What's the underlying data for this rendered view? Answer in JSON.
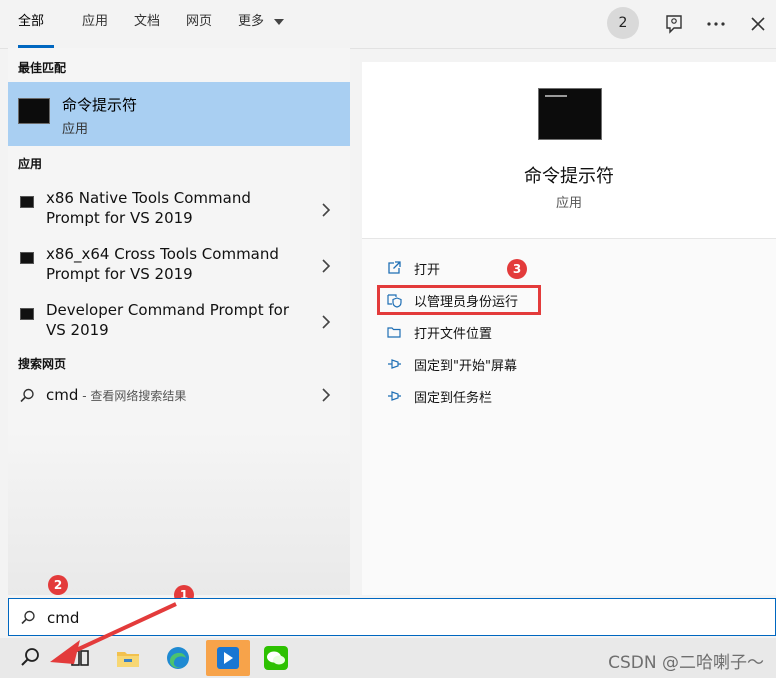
{
  "tabs": [
    {
      "label": "全部",
      "active": true
    },
    {
      "label": "应用"
    },
    {
      "label": "文档"
    },
    {
      "label": "网页"
    },
    {
      "label": "更多"
    }
  ],
  "top_right": {
    "badge": "2",
    "icons": [
      "feedback-icon",
      "more-icon",
      "close-icon"
    ]
  },
  "left": {
    "best_match_title": "最佳匹配",
    "best_match": {
      "name": "命令提示符",
      "type": "应用"
    },
    "apps_title": "应用",
    "apps": [
      {
        "label": "x86 Native Tools Command Prompt for VS 2019"
      },
      {
        "label": "x86_x64 Cross Tools Command Prompt for VS 2019"
      },
      {
        "label": "Developer Command Prompt for VS 2019"
      }
    ],
    "web_title": "搜索网页",
    "web": {
      "query": "cmd",
      "suffix": " - 查看网络搜索结果"
    }
  },
  "right": {
    "title": "命令提示符",
    "subtitle": "应用",
    "actions": [
      {
        "label": "打开",
        "icon": "open-icon"
      },
      {
        "label": "以管理员身份运行",
        "icon": "shield-icon"
      },
      {
        "label": "打开文件位置",
        "icon": "folder-icon"
      },
      {
        "label": "固定到\"开始\"屏幕",
        "icon": "pin-icon"
      },
      {
        "label": "固定到任务栏",
        "icon": "pin-icon"
      }
    ]
  },
  "annotations": [
    "1",
    "2",
    "3"
  ],
  "search": {
    "value": "cmd"
  },
  "watermark": "CSDN @二哈喇子～",
  "colors": {
    "accent": "#0067c0",
    "selection": "#a9cff2",
    "annotation": "#e33b3b",
    "taskbar_active": "#f7a34a"
  }
}
